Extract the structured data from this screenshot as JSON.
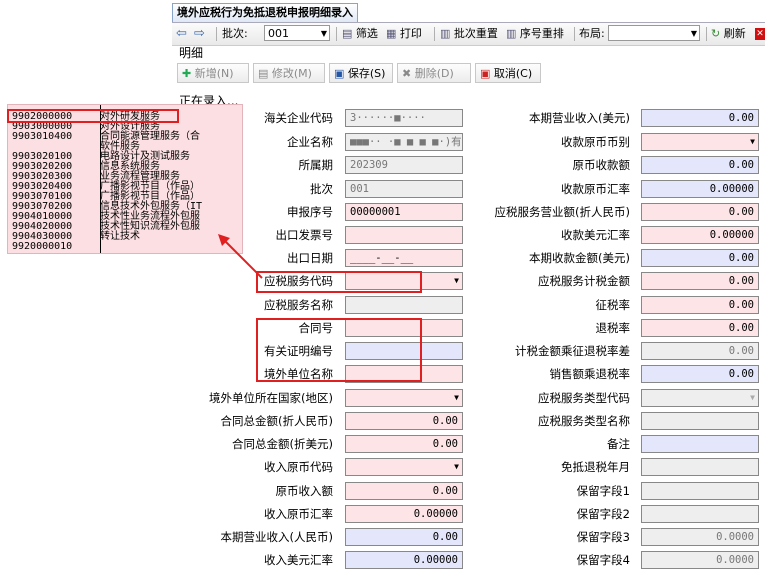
{
  "window": {
    "title": "境外应税行为免抵退税申报明细录入",
    "section": "明细",
    "status": "正在录入..."
  },
  "toolbar_top": {
    "back": "⇦",
    "forward": "⇨",
    "batch_label": "批次:",
    "batch_value": "001",
    "filter": "筛选",
    "print": "打印",
    "reset_batch": "批次重置",
    "reset_seq": "序号重排",
    "layout_label": "布局:",
    "layout_value": "",
    "refresh": "刷新"
  },
  "toolbar_edit": {
    "add": "新增(N)",
    "edit": "修改(M)",
    "save": "保存(S)",
    "delete": "删除(D)",
    "cancel": "取消(C)"
  },
  "popup": [
    {
      "code": "9902000000",
      "name": "对外研发服务"
    },
    {
      "code": "9903000000",
      "name": "对外设计服务"
    },
    {
      "code": "9903010400",
      "name": "合同能源管理服务（合"
    },
    {
      "code": "",
      "name": "软件服务"
    },
    {
      "code": "9903020100",
      "name": "电路设计及测试服务"
    },
    {
      "code": "9903020200",
      "name": "信息系统服务"
    },
    {
      "code": "9903020300",
      "name": "业务流程管理服务"
    },
    {
      "code": "9903020400",
      "name": "广播影视节目（作品）"
    },
    {
      "code": "9903070100",
      "name": "广播影视节目（作品）"
    },
    {
      "code": "9903070200",
      "name": "信息技术外包服务（IT"
    },
    {
      "code": "9904010000",
      "name": "技术性业务流程外包服"
    },
    {
      "code": "9904020000",
      "name": "技术性知识流程外包服"
    },
    {
      "code": "9904030000",
      "name": "转让技术"
    },
    {
      "code": "9920000010",
      "name": ""
    }
  ],
  "left_fields": [
    {
      "label": "海关企业代码",
      "value": "3······■····"
    },
    {
      "label": "企业名称",
      "value": "■■■·· ·■ ■ ■ ■·)有限"
    },
    {
      "label": "所属期",
      "value": "202309"
    },
    {
      "label": "批次",
      "value": "001"
    },
    {
      "label": "申报序号",
      "value": "00000001"
    },
    {
      "label": "出口发票号",
      "value": ""
    },
    {
      "label": "出口日期",
      "value": "____-__-__"
    },
    {
      "label": "应税服务代码",
      "value": ""
    },
    {
      "label": "应税服务名称",
      "value": ""
    },
    {
      "label": "合同号",
      "value": ""
    },
    {
      "label": "有关证明编号",
      "value": ""
    },
    {
      "label": "境外单位名称",
      "value": ""
    }
  ],
  "left_wide_fields": [
    {
      "label": "境外单位所在国家(地区)",
      "value": ""
    },
    {
      "label": "合同总金额(折人民币)",
      "value": "0.00"
    },
    {
      "label": "合同总金额(折美元)",
      "value": "0.00"
    },
    {
      "label": "收入原币代码",
      "value": ""
    },
    {
      "label": "原币收入额",
      "value": "0.00"
    },
    {
      "label": "收入原币汇率",
      "value": "0.00000"
    },
    {
      "label": "本期营业收入(人民币)",
      "value": "0.00"
    },
    {
      "label": "收入美元汇率",
      "value": "0.00000"
    }
  ],
  "right_fields": [
    {
      "label": "本期营业收入(美元)",
      "value": "0.00"
    },
    {
      "label": "收款原币币别",
      "value": ""
    },
    {
      "label": "原币收款额",
      "value": "0.00"
    },
    {
      "label": "收款原币汇率",
      "value": "0.00000"
    },
    {
      "label": "应税服务营业额(折人民币)",
      "value": "0.00"
    },
    {
      "label": "收款美元汇率",
      "value": "0.00000"
    },
    {
      "label": "本期收款金额(美元)",
      "value": "0.00"
    },
    {
      "label": "应税服务计税金额",
      "value": "0.00"
    },
    {
      "label": "征税率",
      "value": "0.00"
    },
    {
      "label": "退税率",
      "value": "0.00"
    },
    {
      "label": "计税金额乘征退税率差",
      "value": "0.00"
    },
    {
      "label": "销售额乘退税率",
      "value": "0.00"
    },
    {
      "label": "应税服务类型代码",
      "value": ""
    },
    {
      "label": "应税服务类型名称",
      "value": ""
    },
    {
      "label": "备注",
      "value": ""
    },
    {
      "label": "免抵退税年月",
      "value": ""
    },
    {
      "label": "保留字段1",
      "value": ""
    },
    {
      "label": "保留字段2",
      "value": ""
    },
    {
      "label": "保留字段3",
      "value": "0.0000"
    },
    {
      "label": "保留字段4",
      "value": "0.0000"
    }
  ]
}
